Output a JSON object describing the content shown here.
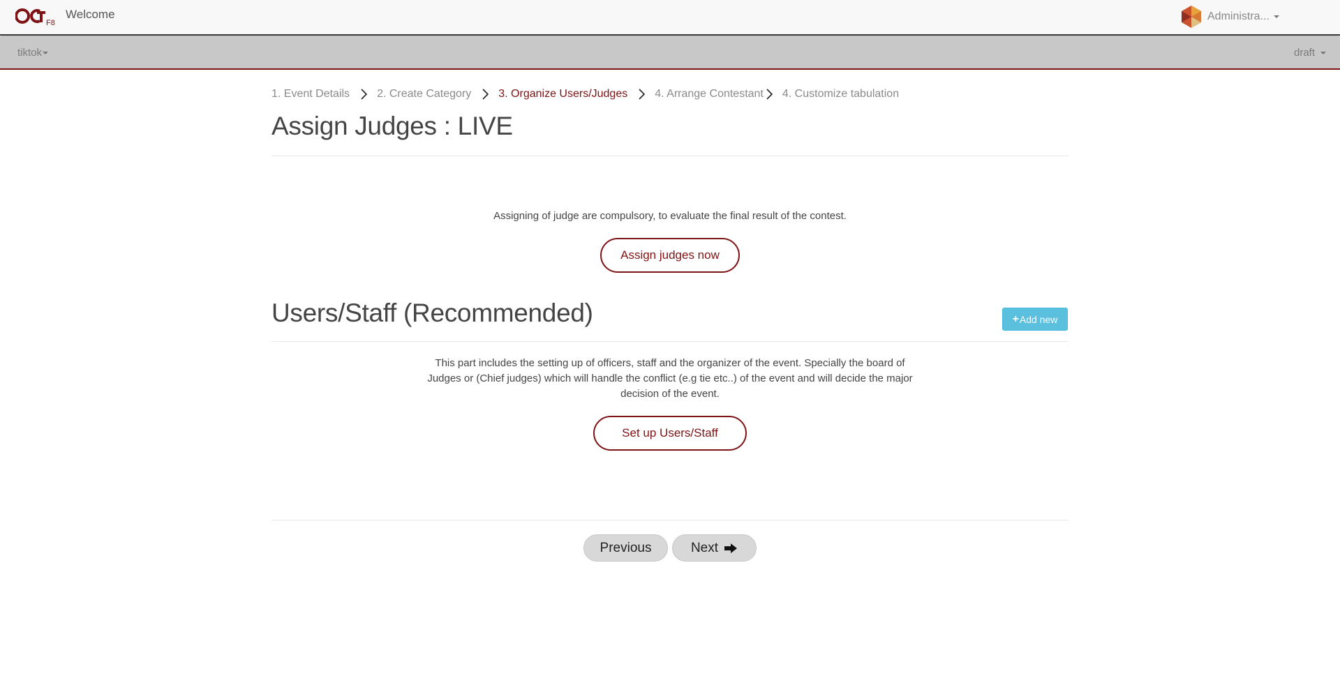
{
  "header": {
    "welcome": "Welcome",
    "user_name": "Administra..."
  },
  "subnav": {
    "left_menu": "tiktok",
    "right_menu": "draft"
  },
  "wizard": {
    "steps": [
      {
        "label": "1. Event Details",
        "active": false
      },
      {
        "label": "2. Create Category",
        "active": false
      },
      {
        "label": "3. Organize Users/Judges",
        "active": true
      },
      {
        "label": "4. Arrange Contestant",
        "active": false
      },
      {
        "label": "4. Customize tabulation",
        "active": false
      }
    ]
  },
  "judges_section": {
    "title": "Assign Judges : LIVE",
    "description": "Assigning of judge are compulsory, to evaluate the final result of the contest.",
    "button": "Assign judges now"
  },
  "users_section": {
    "title": "Users/Staff (Recommended)",
    "add_button": "Add new",
    "add_icon": "plus-icon",
    "description": "This part includes the setting up of officers, staff and the organizer of the event. Specially the board of Judges or (Chief judges) which will handle the conflict (e.g tie etc..) of the event and will decide the major decision of the event.",
    "button": "Set up Users/Staff"
  },
  "footer_nav": {
    "previous": "Previous",
    "next": "Next",
    "next_icon": "arrow-right-icon"
  },
  "colors": {
    "accent": "#7d1315",
    "info": "#5bc0de",
    "subnav_bg": "#c8c8c8"
  }
}
